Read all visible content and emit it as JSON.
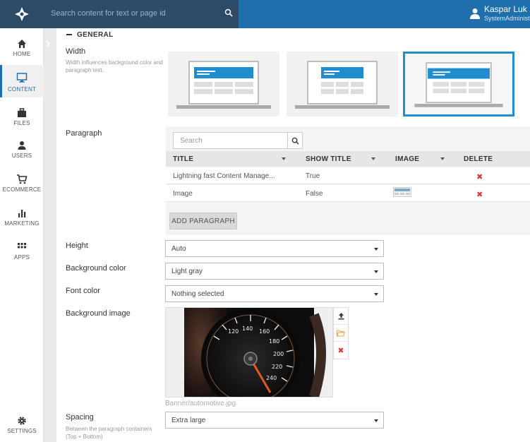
{
  "topbar": {
    "search_placeholder": "Search content for text or page id",
    "user_name": "Kaspar Luk",
    "user_role": "SystemAdministr"
  },
  "sidebar": {
    "items": [
      {
        "label": "HOME",
        "icon": "home-icon"
      },
      {
        "label": "CONTENT",
        "icon": "monitor-icon",
        "active": true
      },
      {
        "label": "FILES",
        "icon": "briefcase-icon"
      },
      {
        "label": "USERS",
        "icon": "user-icon"
      },
      {
        "label": "ECOMMERCE",
        "icon": "cart-icon"
      },
      {
        "label": "MARKETING",
        "icon": "bar-chart-icon"
      },
      {
        "label": "APPS",
        "icon": "grid-icon"
      }
    ],
    "settings_label": "SETTINGS"
  },
  "section": {
    "title": "GENERAL"
  },
  "width": {
    "label": "Width",
    "description": "Width influences background color and paragraph text.",
    "selected_index": 2
  },
  "paragraph": {
    "label": "Paragraph",
    "search_placeholder": "Search",
    "columns": [
      "TITLE",
      "SHOW TITLE",
      "IMAGE",
      "DELETE"
    ],
    "rows": [
      {
        "title": "Lightning fast Content Manage...",
        "show_title": "True",
        "has_image": false
      },
      {
        "title": "Image",
        "show_title": "False",
        "has_image": true
      }
    ],
    "add_button": "ADD PARAGRAPH"
  },
  "height": {
    "label": "Height",
    "value": "Auto"
  },
  "background_color": {
    "label": "Background color",
    "value": "Light gray"
  },
  "font_color": {
    "label": "Font color",
    "value": "Nothing selected"
  },
  "background_image": {
    "label": "Background image",
    "filename": "Banner/automotive.jpg"
  },
  "spacing": {
    "label": "Spacing",
    "description": "Between the paragraph containers (Top + Bottom)",
    "value": "Extra large"
  },
  "colors": {
    "brand": "#1f6fad",
    "topbar_dark": "#2d4a66",
    "selected_border": "#1f8dd0",
    "delete_red": "#d23b3b"
  }
}
